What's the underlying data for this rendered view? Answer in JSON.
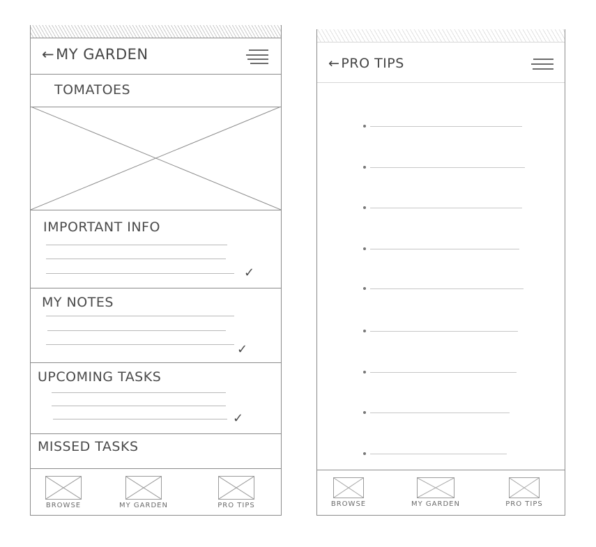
{
  "left_screen": {
    "header": {
      "back_arrow": "←",
      "title": "MY GARDEN",
      "menu_icon": "hamburger-menu-icon"
    },
    "section_tomatoes": "TOMATOES",
    "image_icon": "image-placeholder-icon",
    "sections": [
      {
        "title": "IMPORTANT INFO",
        "check": "✓"
      },
      {
        "title": "MY NOTES",
        "check": "✓"
      },
      {
        "title": "UPCOMING TASKS",
        "check": "✓"
      },
      {
        "title": "MISSED TASKS"
      }
    ],
    "bottom_nav": [
      {
        "label": "BROWSE"
      },
      {
        "label": "MY GARDEN"
      },
      {
        "label": "PRO TIPS"
      }
    ]
  },
  "right_screen": {
    "header": {
      "back_arrow": "←",
      "title": "PRO TIPS",
      "menu_icon": "hamburger-menu-icon"
    },
    "bottom_nav": [
      {
        "label": "BROWSE"
      },
      {
        "label": "MY GARDEN"
      },
      {
        "label": "PRO TIPS"
      }
    ]
  },
  "colors": {
    "sketch_stroke": "#4a4a4a",
    "faint_line": "#c6c6c6"
  }
}
